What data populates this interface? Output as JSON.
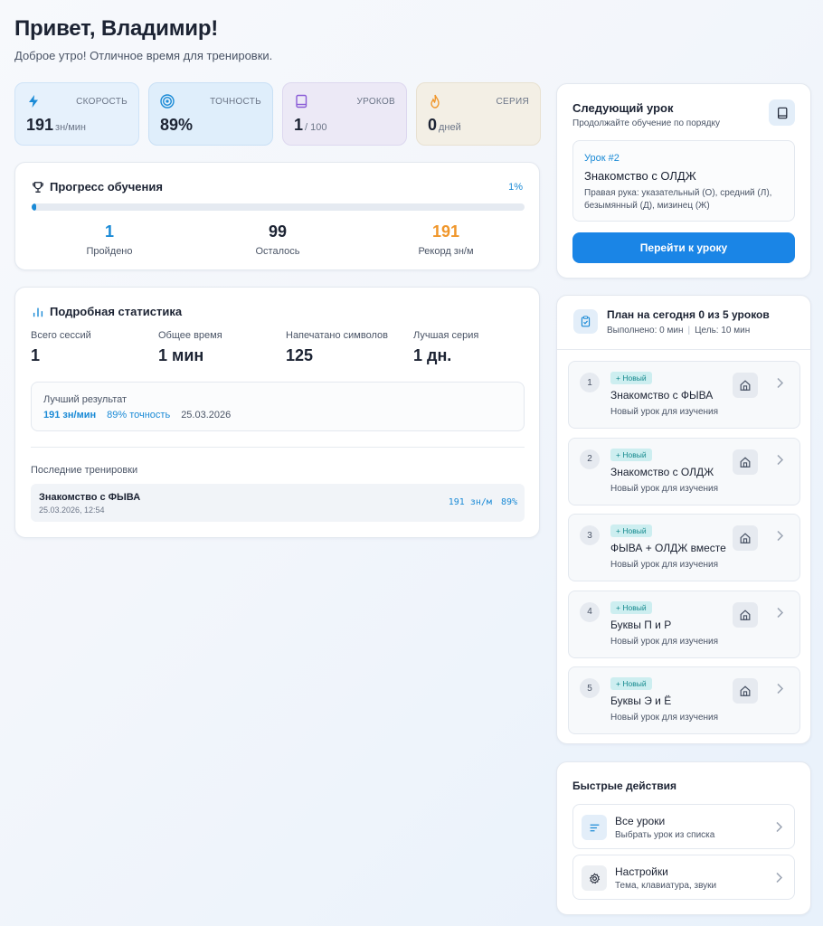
{
  "header": {
    "greeting": "Привет, Владимир!",
    "subtitle": "Доброе утро! Отличное время для тренировки."
  },
  "stats": [
    {
      "label": "СКОРОСТЬ",
      "value": "191",
      "unit": "зн/мин",
      "icon": "lightning-icon",
      "color": "#1a8ad6"
    },
    {
      "label": "ТОЧНОСТЬ",
      "value": "89%",
      "unit": "",
      "icon": "target-icon",
      "color": "#1a8ad6"
    },
    {
      "label": "УРОКОВ",
      "value": "1",
      "unit": "/ 100",
      "icon": "book-icon",
      "color": "#8a5cd6"
    },
    {
      "label": "СЕРИЯ",
      "value": "0",
      "unit": "дней",
      "icon": "flame-icon",
      "color": "#f0962a"
    }
  ],
  "progress": {
    "title": "Прогресс обучения",
    "percent_label": "1%",
    "percent": 1,
    "completed_value": "1",
    "completed_label": "Пройдено",
    "remaining_value": "99",
    "remaining_label": "Осталось",
    "record_value": "191",
    "record_label": "Рекорд зн/м"
  },
  "details": {
    "title": "Подробная статистика",
    "metrics": [
      {
        "label": "Всего сессий",
        "value": "1"
      },
      {
        "label": "Общее время",
        "value": "1 мин"
      },
      {
        "label": "Напечатано символов",
        "value": "125"
      },
      {
        "label": "Лучшая серия",
        "value": "1 дн."
      }
    ],
    "best_label": "Лучший результат",
    "best_speed": "191 зн/мин",
    "best_accuracy": "89% точность",
    "best_date": "25.03.2026",
    "recent_label": "Последние тренировки",
    "recent": {
      "name": "Знакомство с ФЫВА",
      "date": "25.03.2026, 12:54",
      "speed": "191 зн/м",
      "accuracy": "89%"
    }
  },
  "next_lesson": {
    "title": "Следующий урок",
    "subtitle": "Продолжайте обучение по порядку",
    "number": "Урок #2",
    "name": "Знакомство с ОЛДЖ",
    "description": "Правая рука: указательный (О), средний (Л), безымянный (Д), мизинец (Ж)",
    "button": "Перейти к уроку"
  },
  "plan": {
    "title": "План на сегодня 0 из 5 уроков",
    "done": "Выполнено: 0 мин",
    "goal": "Цель: 10 мин",
    "badge": "+ Новый",
    "items": [
      {
        "num": "1",
        "name": "Знакомство с ФЫВА",
        "sub": "Новый урок для изучения"
      },
      {
        "num": "2",
        "name": "Знакомство с ОЛДЖ",
        "sub": "Новый урок для изучения"
      },
      {
        "num": "3",
        "name": "ФЫВА + ОЛДЖ вместе",
        "sub": "Новый урок для изучения"
      },
      {
        "num": "4",
        "name": "Буквы П и Р",
        "sub": "Новый урок для изучения"
      },
      {
        "num": "5",
        "name": "Буквы Э и Ё",
        "sub": "Новый урок для изучения"
      }
    ]
  },
  "quick": {
    "title": "Быстрые действия",
    "actions": [
      {
        "name": "Все уроки",
        "desc": "Выбрать урок из списка",
        "icon": "list-icon"
      },
      {
        "name": "Настройки",
        "desc": "Тема, клавиатура, звуки",
        "icon": "gear-icon"
      }
    ]
  }
}
